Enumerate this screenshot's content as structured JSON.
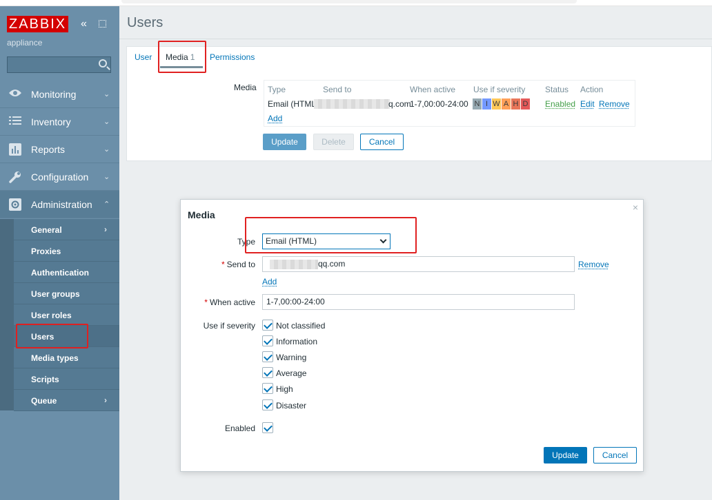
{
  "sidebar": {
    "logo": "ZABBIX",
    "subtitle": "appliance",
    "search_placeholder": "",
    "menu": [
      {
        "label": "Monitoring",
        "arrow": "⌄"
      },
      {
        "label": "Inventory",
        "arrow": "⌄"
      },
      {
        "label": "Reports",
        "arrow": "⌄"
      },
      {
        "label": "Configuration",
        "arrow": "⌄"
      },
      {
        "label": "Administration",
        "arrow": "⌃"
      }
    ],
    "submenu": [
      {
        "label": "General",
        "arrow": "›"
      },
      {
        "label": "Proxies",
        "arrow": ""
      },
      {
        "label": "Authentication",
        "arrow": ""
      },
      {
        "label": "User groups",
        "arrow": ""
      },
      {
        "label": "User roles",
        "arrow": ""
      },
      {
        "label": "Users",
        "arrow": ""
      },
      {
        "label": "Media types",
        "arrow": ""
      },
      {
        "label": "Scripts",
        "arrow": ""
      },
      {
        "label": "Queue",
        "arrow": "›"
      }
    ]
  },
  "page": {
    "title": "Users",
    "tabs": [
      {
        "label": "User",
        "count": ""
      },
      {
        "label": "Media",
        "count": "1"
      },
      {
        "label": "Permissions",
        "count": ""
      }
    ],
    "media_label": "Media",
    "table": {
      "headers": [
        "Type",
        "Send to",
        "When active",
        "Use if severity",
        "Status",
        "Action"
      ],
      "row": {
        "type": "Email (HTML",
        "send_to_suffix": "q.com",
        "when_active": "1-7,00:00-24:00",
        "severity": [
          "N",
          "I",
          "W",
          "A",
          "H",
          "D"
        ],
        "status": "Enabled",
        "edit": "Edit",
        "remove": "Remove"
      },
      "add": "Add"
    },
    "buttons": {
      "update": "Update",
      "delete": "Delete",
      "cancel": "Cancel"
    }
  },
  "modal": {
    "title": "Media",
    "close": "×",
    "type_label": "Type",
    "type_value": "Email (HTML)",
    "send_to_label": "Send to",
    "send_to_value": "qq.com",
    "remove": "Remove",
    "add": "Add",
    "when_active_label": "When active",
    "when_active_value": "1-7,00:00-24:00",
    "severity_label": "Use if severity",
    "severities": [
      "Not classified",
      "Information",
      "Warning",
      "Average",
      "High",
      "Disaster"
    ],
    "enabled_label": "Enabled",
    "update": "Update",
    "cancel": "Cancel"
  },
  "colors": {
    "sidebar": "#6b8fa9",
    "accent": "#0275b8",
    "logo_bg": "#d40000",
    "annotation": "#e02020",
    "sev_not_classified": "#97aab3",
    "sev_information": "#7499ff",
    "sev_warning": "#ffc859",
    "sev_average": "#ffa059",
    "sev_high": "#e97659",
    "sev_disaster": "#e45959"
  }
}
